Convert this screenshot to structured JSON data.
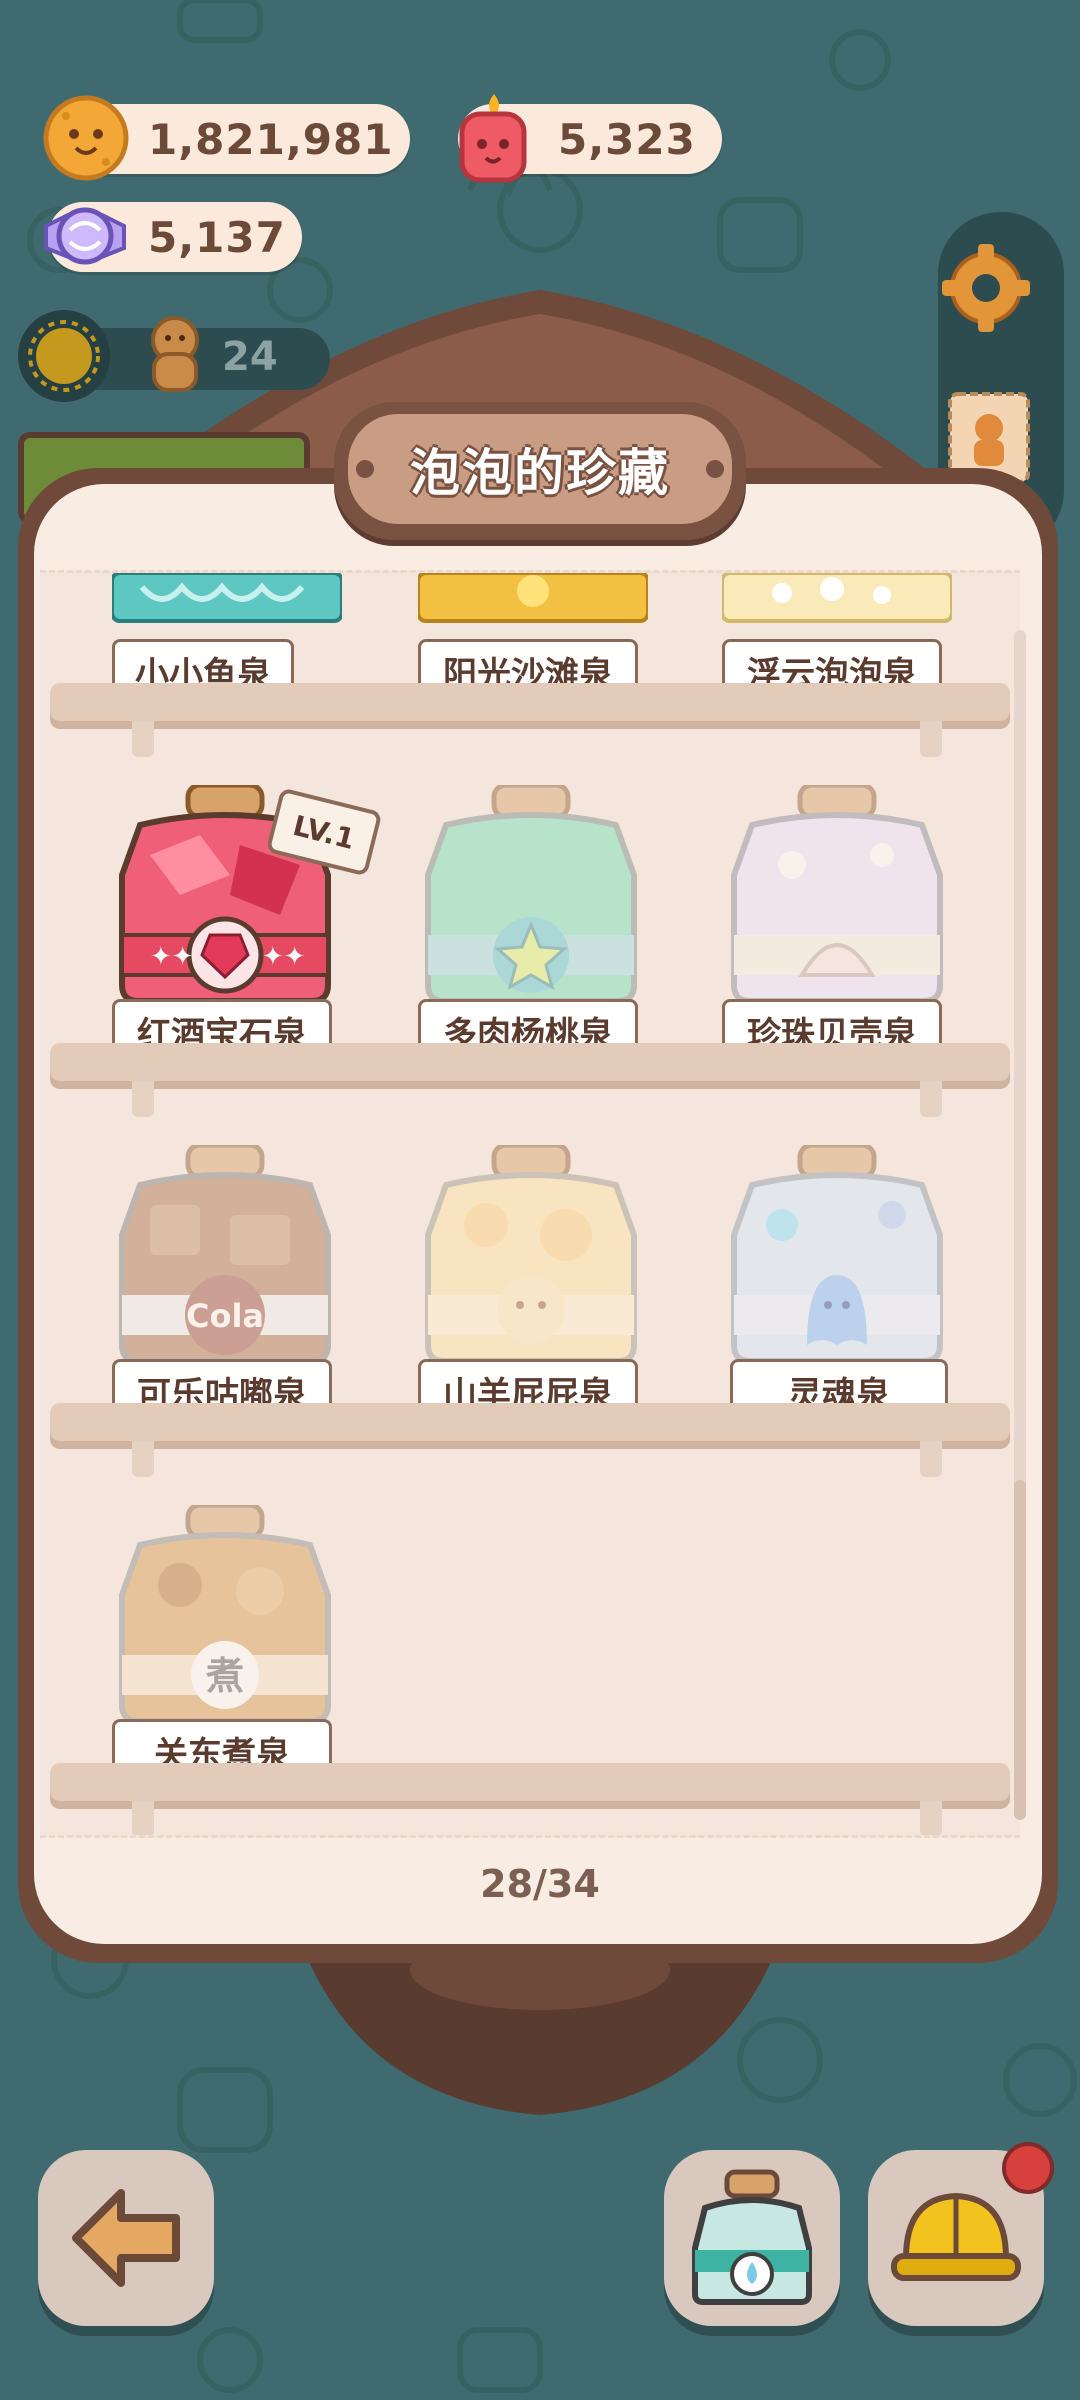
{
  "currencies": {
    "cookies": "1,821,981",
    "candles": "5,323",
    "candy": "5,137"
  },
  "level": {
    "value": "24"
  },
  "panel": {
    "title": "泡泡的珍藏",
    "page": "28/34"
  },
  "fountains": {
    "row0": [
      {
        "label": "小小鱼泉"
      },
      {
        "label": "阳光沙滩泉"
      },
      {
        "label": "浮云泡泡泉"
      }
    ],
    "row1": [
      {
        "label": "红酒宝石泉",
        "level_badge": "LV.1",
        "unlocked": true
      },
      {
        "label": "多肉杨桃泉",
        "unlocked": false
      },
      {
        "label": "珍珠贝壳泉",
        "unlocked": false
      }
    ],
    "row2": [
      {
        "label": "可乐咕嘟泉",
        "jar_text": "Cola",
        "unlocked": false
      },
      {
        "label": "山羊屁屁泉",
        "unlocked": false
      },
      {
        "label": "灵魂泉",
        "unlocked": false
      }
    ],
    "row3": [
      {
        "label": "关东煮泉",
        "jar_text": "煮",
        "unlocked": false
      }
    ]
  },
  "colors": {
    "background": "#3f6a6f",
    "panel": "#f8ece3",
    "panel_border": "#6f4a3a",
    "label_text": "#5a3b2e"
  },
  "icons": [
    "cookie-icon",
    "candle-icon",
    "candy-icon",
    "gear-icon",
    "back-arrow-icon",
    "jar-icon",
    "helmet-icon"
  ]
}
